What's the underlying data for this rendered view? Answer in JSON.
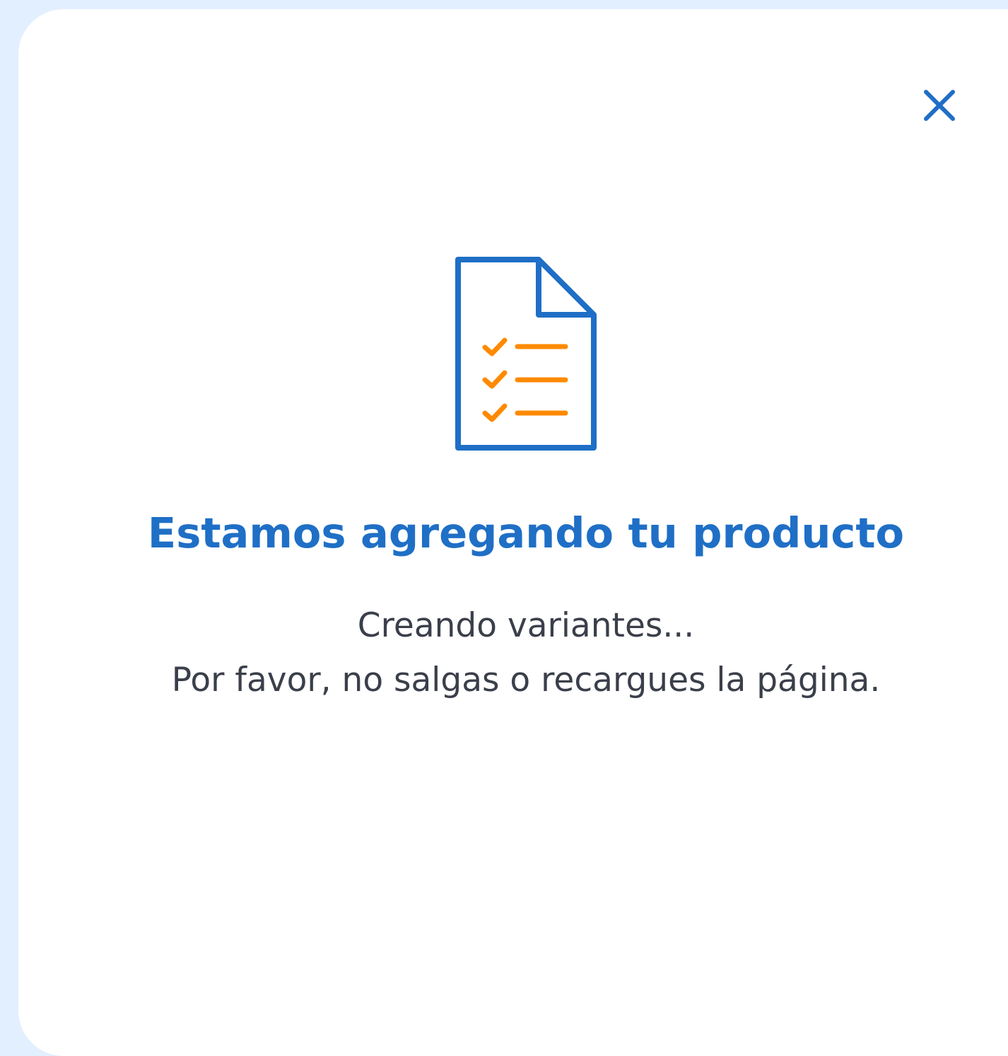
{
  "dialog": {
    "title": "Estamos agregando tu producto",
    "status_text": "Creando variantes...",
    "warning_text": "Por favor, no salgas o recargues la página.",
    "close_icon": "close-icon",
    "illustration_icon": "checklist-document-icon"
  },
  "colors": {
    "background": "#e2efff",
    "dialog": "#ffffff",
    "primary_blue": "#1f6fc6",
    "accent_orange": "#ff8a00",
    "body_text": "#3a3f4a"
  }
}
